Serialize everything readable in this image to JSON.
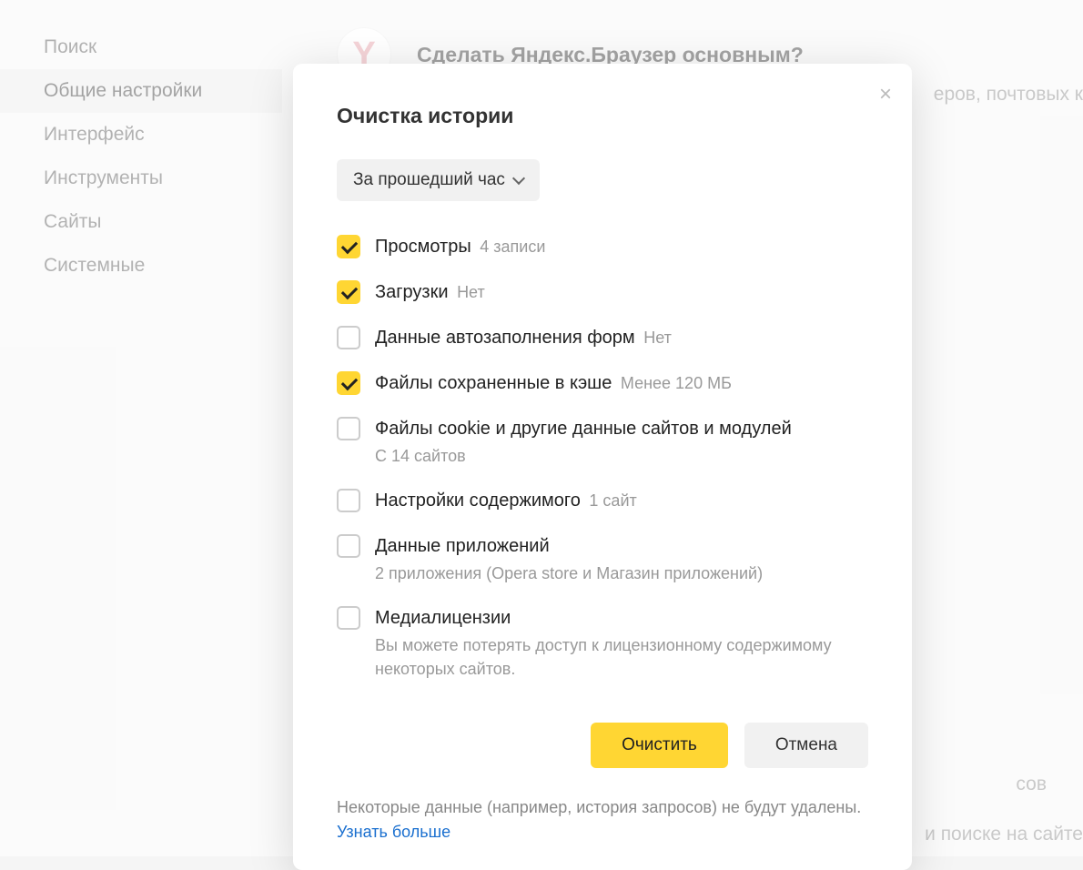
{
  "sidebar": {
    "items": [
      {
        "label": "Поиск"
      },
      {
        "label": "Общие настройки"
      },
      {
        "label": "Интерфейс"
      },
      {
        "label": "Инструменты"
      },
      {
        "label": "Сайты"
      },
      {
        "label": "Системные"
      }
    ],
    "active_index": 1
  },
  "banner": {
    "title": "Сделать Яндекс.Браузер основным?"
  },
  "bg_fragments": {
    "r1": "еров, почтовых к",
    "r2": "сов",
    "r3": "и поиске на сайте"
  },
  "modal": {
    "title": "Очистка истории",
    "range": "За прошедший час",
    "checkboxes": [
      {
        "label": "Просмотры",
        "hint": "4 записи",
        "checked": true
      },
      {
        "label": "Загрузки",
        "hint": "Нет",
        "checked": true
      },
      {
        "label": "Данные автозаполнения форм",
        "hint": "Нет",
        "checked": false
      },
      {
        "label": "Файлы сохраненные в кэше",
        "hint": "Менее 120 МБ",
        "checked": true
      },
      {
        "label": "Файлы cookie и другие данные сайтов и модулей",
        "sub": "С 14 сайтов",
        "checked": false
      },
      {
        "label": "Настройки содержимого",
        "hint": "1 сайт",
        "checked": false
      },
      {
        "label": "Данные приложений",
        "sub": "2 приложения (Opera store и Магазин приложений)",
        "checked": false
      },
      {
        "label": "Медиалицензии",
        "sub": "Вы можете потерять доступ к лицензионному содержимому некоторых сайтов.",
        "checked": false
      }
    ],
    "buttons": {
      "primary": "Очистить",
      "secondary": "Отмена"
    },
    "footer_note": "Некоторые данные (например, история запросов) не будут удалены.",
    "footer_link": "Узнать больше"
  }
}
